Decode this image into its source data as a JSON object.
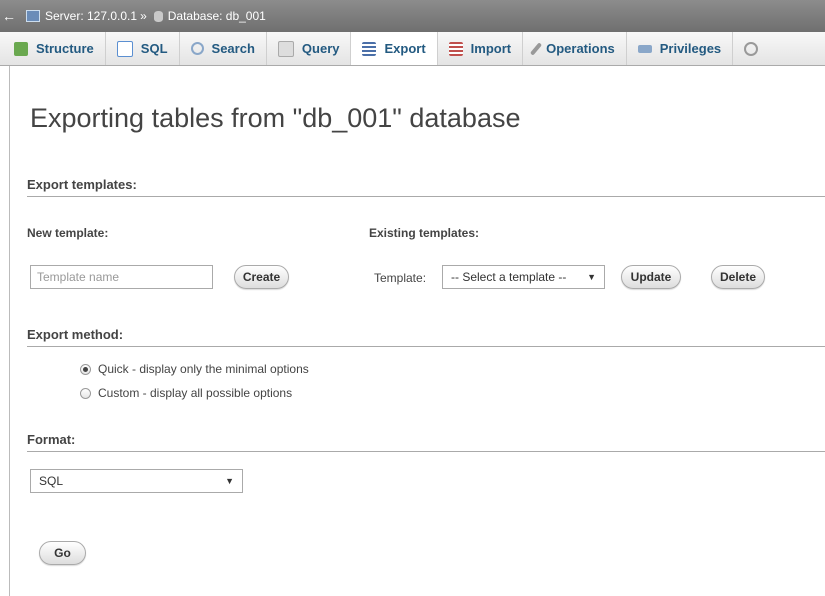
{
  "breadcrumb": {
    "back_glyph": "←",
    "server": "Server: 127.0.0.1",
    "separator": "»",
    "database": "Database: db_001"
  },
  "tabs": [
    {
      "label": "Structure",
      "icon": "structure-icon",
      "color": "#6aa84f",
      "active": false
    },
    {
      "label": "SQL",
      "icon": "sql-icon",
      "color": "#5b8fd1",
      "active": false
    },
    {
      "label": "Search",
      "icon": "search-icon",
      "color": "#8aa7c9",
      "active": false
    },
    {
      "label": "Query",
      "icon": "query-icon",
      "color": "#bbbbbb",
      "active": false
    },
    {
      "label": "Export",
      "icon": "export-icon",
      "color": "#4b6fa8",
      "active": true
    },
    {
      "label": "Import",
      "icon": "import-icon",
      "color": "#c0504d",
      "active": false
    },
    {
      "label": "Operations",
      "icon": "wrench-icon",
      "color": "#999999",
      "active": false
    },
    {
      "label": "Privileges",
      "icon": "privileges-icon",
      "color": "#8aa7c9",
      "active": false
    },
    {
      "label": "",
      "icon": "routines-icon",
      "color": "#999999",
      "active": false
    }
  ],
  "page_title": "Exporting tables from \"db_001\" database",
  "export_templates": {
    "heading": "Export templates:",
    "new_template_label": "New template:",
    "template_name_placeholder": "Template name",
    "create_button": "Create",
    "existing_templates_label": "Existing templates:",
    "template_label": "Template:",
    "template_select_value": "-- Select a template --",
    "update_button": "Update",
    "delete_button": "Delete"
  },
  "export_method": {
    "heading": "Export method:",
    "options": [
      {
        "label": "Quick - display only the minimal options",
        "selected": true
      },
      {
        "label": "Custom - display all possible options",
        "selected": false
      }
    ]
  },
  "format": {
    "heading": "Format:",
    "selected": "SQL"
  },
  "go_button": "Go"
}
